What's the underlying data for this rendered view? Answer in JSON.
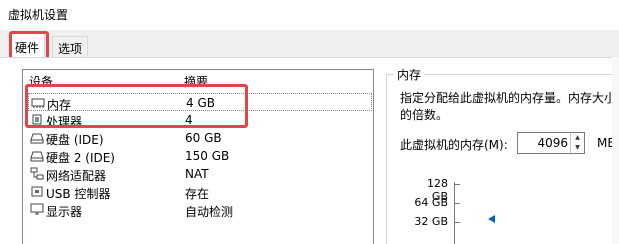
{
  "window": {
    "title": "虚拟机设置"
  },
  "tabs": [
    {
      "label": "硬件"
    },
    {
      "label": "选项"
    }
  ],
  "device_list": {
    "columns": {
      "device": "设备",
      "summary": "摘要"
    },
    "rows": [
      {
        "name": "内存",
        "summary": "4 GB",
        "icon": "memory-icon"
      },
      {
        "name": "处理器",
        "summary": "4",
        "icon": "cpu-icon"
      },
      {
        "name": "硬盘 (IDE)",
        "summary": "60 GB",
        "icon": "disk-icon"
      },
      {
        "name": "硬盘 2 (IDE)",
        "summary": "150 GB",
        "icon": "disk-icon"
      },
      {
        "name": "网络适配器",
        "summary": "NAT",
        "icon": "network-icon"
      },
      {
        "name": "USB 控制器",
        "summary": "存在",
        "icon": "usb-icon"
      },
      {
        "name": "显示器",
        "summary": "自动检测",
        "icon": "monitor-icon"
      }
    ]
  },
  "memory_panel": {
    "title": "内存",
    "description_line1": "指定分配给此虚拟机的内存量。内存大小",
    "description_line2": "的倍数。",
    "field_label": "此虚拟机的内存(M):",
    "field_value": "4096",
    "unit": "MB",
    "scale_labels": [
      "128 GB",
      "64 GB",
      "32 GB"
    ]
  },
  "colors": {
    "highlight_box": "#e5444d",
    "pointer": "#0063b1"
  }
}
